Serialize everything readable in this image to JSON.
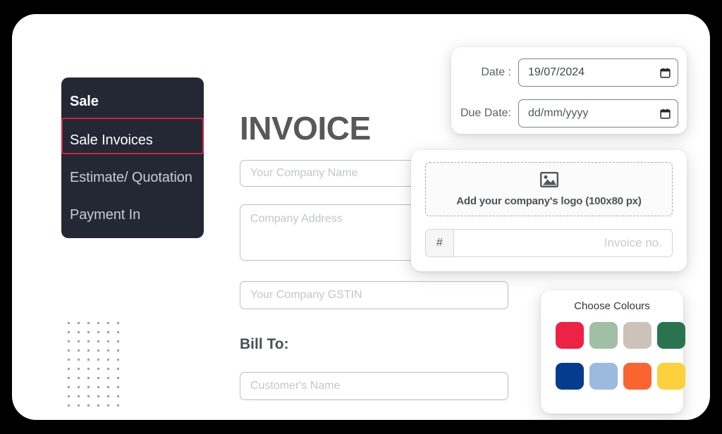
{
  "sidebar": {
    "items": [
      {
        "label": "Sale",
        "state": "header"
      },
      {
        "label": "Sale Invoices",
        "state": "selected"
      },
      {
        "label": "Estimate/ Quotation",
        "state": "normal"
      },
      {
        "label": "Payment In",
        "state": "normal"
      }
    ],
    "highlight_color": "#d1223c",
    "background_color": "#232834"
  },
  "invoice": {
    "title": "INVOICE",
    "bill_to_label": "Bill To:",
    "fields": {
      "company_name_placeholder": "Your Company Name",
      "company_address_placeholder": "Company Address",
      "company_gstin_placeholder": "Your Company GSTIN",
      "customer_name_placeholder": "Customer's Name"
    }
  },
  "date_panel": {
    "date_label": "Date :",
    "date_value": "19/07/2024",
    "due_date_label": "Due Date:",
    "due_date_placeholder": "dd/mm/yyyy",
    "calendar_icon": "calendar-icon"
  },
  "logo_panel": {
    "dropzone_caption": "Add your company's logo (100x80 px)",
    "image_icon": "image-placeholder-icon",
    "invoice_no_prefix": "#",
    "invoice_no_placeholder": "Invoice no."
  },
  "colour_panel": {
    "title": "Choose Colours",
    "swatches": [
      {
        "name": "crimson-red",
        "hex": "#ED2244"
      },
      {
        "name": "sage-green",
        "hex": "#A0BFA4"
      },
      {
        "name": "taupe-beige",
        "hex": "#CCC2B8"
      },
      {
        "name": "forest-green",
        "hex": "#2A7350"
      },
      {
        "name": "navy-blue",
        "hex": "#053C8F"
      },
      {
        "name": "steel-blue",
        "hex": "#9CB9DE"
      },
      {
        "name": "orange",
        "hex": "#FA6430"
      },
      {
        "name": "golden-yellow",
        "hex": "#FCD13D"
      }
    ]
  },
  "decor": {
    "dot_grid_columns": 6,
    "dot_grid_rows": 10
  }
}
